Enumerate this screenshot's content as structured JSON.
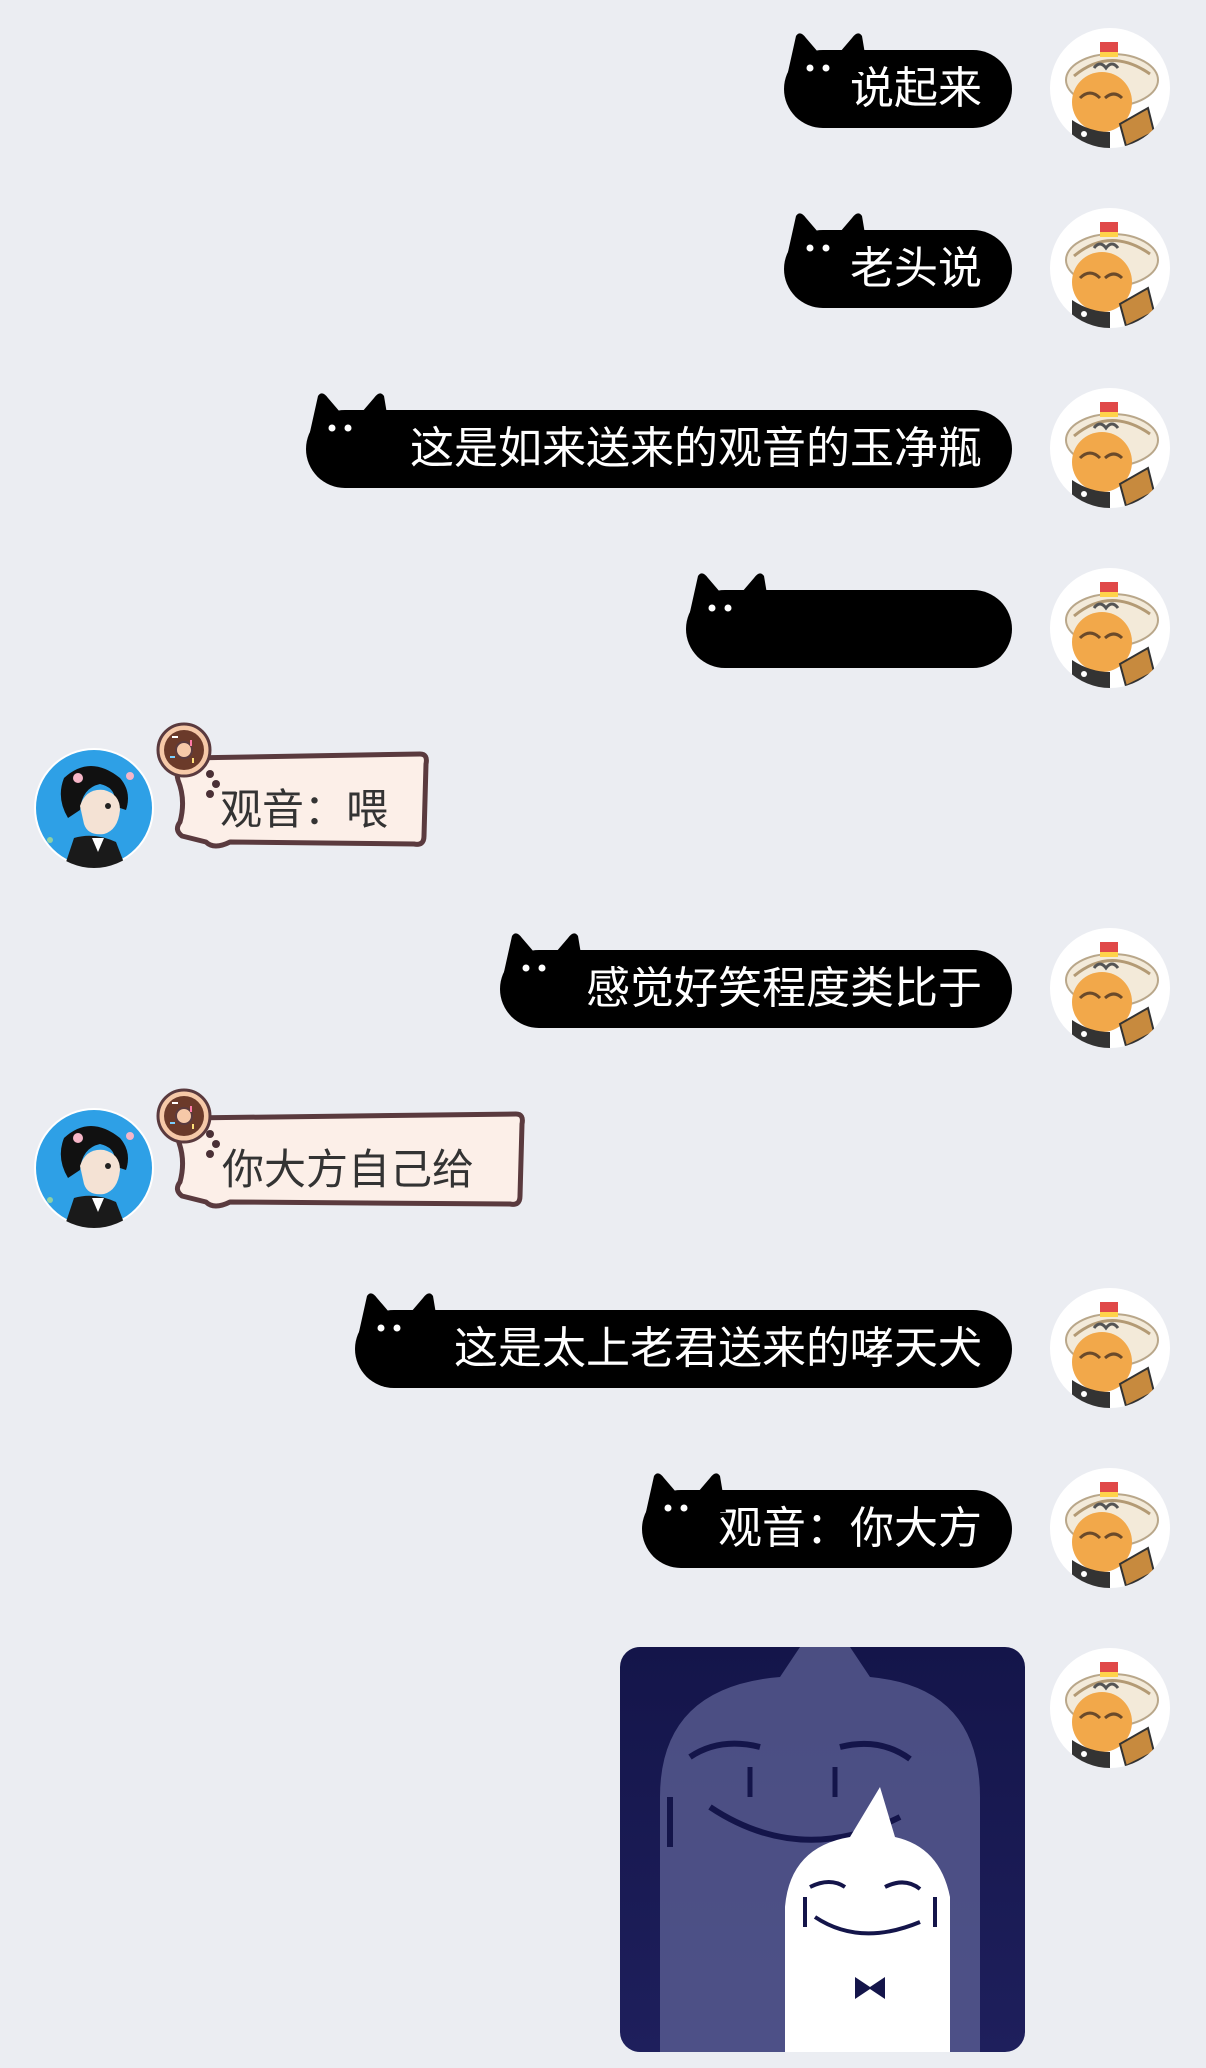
{
  "chat": {
    "messages": [
      {
        "side": "right",
        "kind": "text",
        "text": "说起来"
      },
      {
        "side": "right",
        "kind": "text",
        "text": "老头说"
      },
      {
        "side": "right",
        "kind": "text",
        "text": "这是如来送来的观音的玉净瓶"
      },
      {
        "side": "right",
        "kind": "text",
        "text": ""
      },
      {
        "side": "left",
        "kind": "text",
        "text": "观音：喂"
      },
      {
        "side": "right",
        "kind": "text",
        "text": "感觉好笑程度类比于"
      },
      {
        "side": "left",
        "kind": "text",
        "text": "你大方自己给"
      },
      {
        "side": "right",
        "kind": "text",
        "text": "这是太上老君送来的哮天犬"
      },
      {
        "side": "right",
        "kind": "text",
        "text": "观音：你大方"
      },
      {
        "side": "right",
        "kind": "sticker",
        "text": ""
      }
    ]
  },
  "colors": {
    "background": "#ebedf2",
    "dark_bubble": "#000000",
    "light_bubble": "#fcefe8",
    "light_bubble_border": "#5a3a3e",
    "sticker_bg": "#14154a"
  },
  "icons": {
    "right_avatar": "cartoon-character-with-hat-avatar",
    "left_avatar": "anime-boy-profile-avatar",
    "donut": "donut-icon",
    "cat_ears": "cat-ears-icon"
  }
}
